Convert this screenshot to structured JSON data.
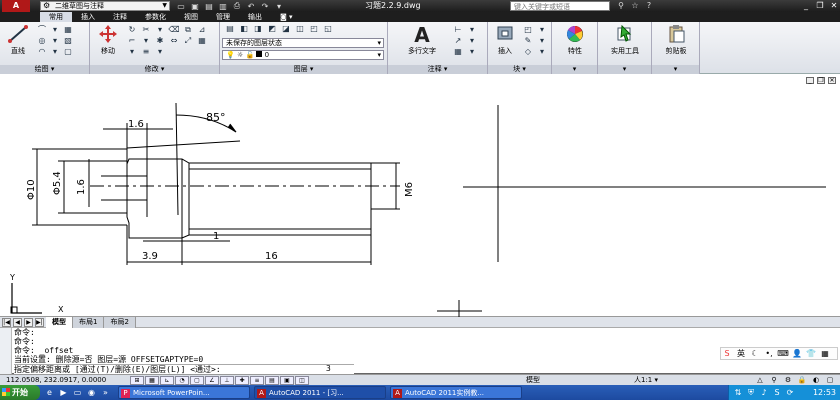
{
  "titlebar": {
    "app_logo": "A",
    "workspace": "二维草图与注释",
    "doc_title": "习题2.2.9.dwg",
    "search_placeholder": "键入关键字或短语",
    "qat_icons": [
      "new-icon",
      "open-icon",
      "save-icon",
      "save-as-icon",
      "plot-icon",
      "undo-icon",
      "redo-icon",
      "dropdown-icon"
    ],
    "title_icons": [
      "binoculars-icon",
      "star-icon",
      "help-icon"
    ],
    "window_buttons": [
      "minimize",
      "restore",
      "close"
    ]
  },
  "ribbon_tabs": [
    "常用",
    "插入",
    "注释",
    "参数化",
    "视图",
    "管理",
    "输出"
  ],
  "ribbon_tab_extra": "◙ ▾",
  "ribbon": {
    "draw": {
      "title": "绘图",
      "line": "直线"
    },
    "modify": {
      "title": "修改",
      "move": "移动"
    },
    "layers": {
      "title": "图层",
      "layer_state": "未保存的图层状态",
      "current_layer": "0"
    },
    "annotation": {
      "title": "注释",
      "mtext": "多行文字"
    },
    "block": {
      "title": "块",
      "insert": "插入"
    },
    "properties": {
      "label": "特性"
    },
    "utilities": {
      "label": "实用工具"
    },
    "clipboard": {
      "label": "剪贴板"
    }
  },
  "drawing": {
    "dims": {
      "angle": "85°",
      "top_width": "1.6",
      "dia10": "Φ10",
      "dia54": "Φ5.4",
      "inner16": "1.6",
      "thread": "M6",
      "chamfer": "1",
      "len39": "3.9",
      "len16": "16"
    },
    "ucs": {
      "x": "X",
      "y": "Y"
    }
  },
  "layout_tabs": [
    "模型",
    "布局1",
    "布局2"
  ],
  "command": {
    "history": [
      "命令:",
      "命令:",
      "命令:  _offset",
      "当前设置: 删除源=否  图层=源  OFFSETGAPTYPE=0"
    ],
    "prompt": "指定偏移距离或 [通过(T)/删除(E)/图层(L)] <通过>:",
    "input": "3"
  },
  "ime": {
    "label": "英"
  },
  "status": {
    "coords": "112.0508, 232.0917, 0.0000",
    "model": "模型",
    "anno_scale": "人1:1 ▾",
    "clock": "12:53"
  },
  "taskbar": {
    "start": "开始",
    "items": [
      {
        "icon": "powerpoint-icon",
        "label": "Microsoft PowerPoin..."
      },
      {
        "icon": "autocad-icon",
        "label": "AutoCAD 2011 - [习..."
      },
      {
        "icon": "autocad-icon",
        "label": "AutoCAD 2011实例教..."
      }
    ]
  },
  "colors": {
    "ribbon_bg": "#dde1e8",
    "titlebar": "#1c1c1c",
    "taskbar": "#2a5fb8",
    "start": "#2a7a2a"
  }
}
